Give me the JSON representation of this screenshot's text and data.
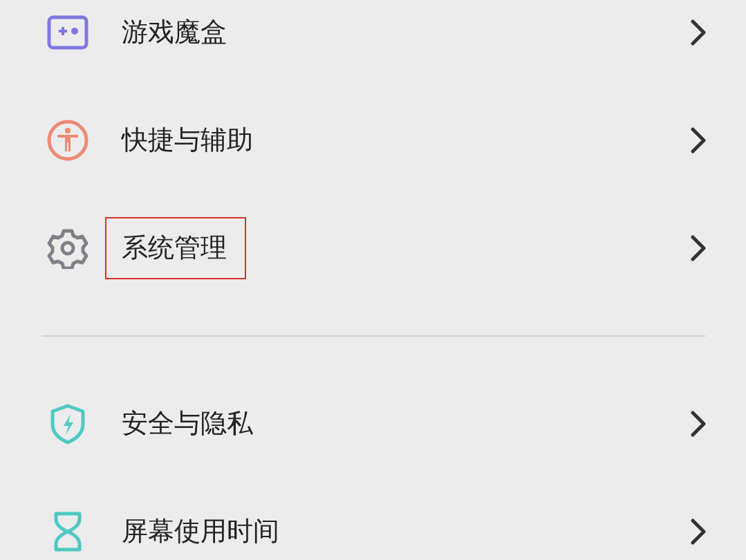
{
  "groups": [
    {
      "items": [
        {
          "label": "游戏魔盒",
          "kind": "gamepad",
          "color": "#7f78e0",
          "highlighted": false
        },
        {
          "label": "快捷与辅助",
          "kind": "accessibility",
          "color": "#ee8a74",
          "highlighted": false
        },
        {
          "label": "系统管理",
          "kind": "gear",
          "color": "#808088",
          "highlighted": true
        }
      ]
    },
    {
      "items": [
        {
          "label": "安全与隐私",
          "kind": "shield",
          "color": "#4ec9c3",
          "highlighted": false
        },
        {
          "label": "屏幕使用时间",
          "kind": "hourglass",
          "color": "#4ec9c3",
          "highlighted": false
        }
      ]
    }
  ]
}
